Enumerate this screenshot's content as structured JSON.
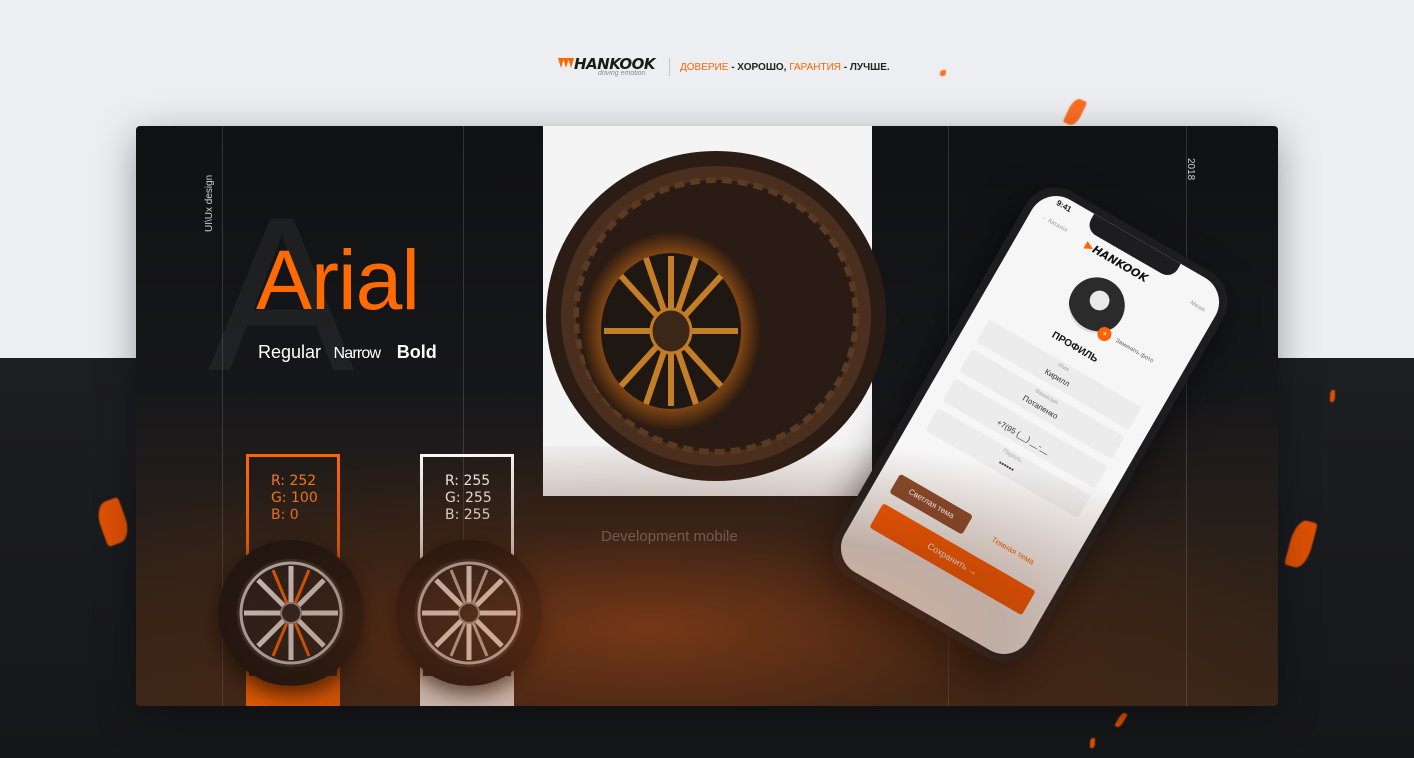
{
  "header": {
    "logo_text": "HANKOOK",
    "logo_sub": "driving emotion",
    "tagline_part1": "ДОВЕРИЕ",
    "tagline_part2": " - ХОРОШО, ",
    "tagline_part3": "ГАРАНТИЯ",
    "tagline_part4": " - ЛУЧШЕ."
  },
  "showcase": {
    "side_label": "UI\\Ux design",
    "year": "2018",
    "big_letter": "A",
    "font_name": "Arial",
    "weights": {
      "regular": "Regular",
      "narrow": "Narrow",
      "bold": "Bold"
    },
    "dev_text": "Development mobile"
  },
  "swatches": [
    {
      "color": "#ff6400",
      "r": "R: 252",
      "g": "G: 100",
      "b": "B: 0"
    },
    {
      "color": "#ffffff",
      "r": "R: 255",
      "g": "G: 255",
      "b": "B: 255"
    }
  ],
  "phone": {
    "time": "9:41",
    "back": "← Каталог",
    "menu": "Меню",
    "logo": "HANKOOK",
    "change_photo": "Заменить фото",
    "title": "ПРОФИЛЬ",
    "fields": [
      {
        "label": "Имя",
        "value": "Кирилл"
      },
      {
        "label": "Фамилия",
        "value": "Потапенко"
      },
      {
        "label": "",
        "value": "+7(95 (__) __-__"
      },
      {
        "label": "Пароль",
        "value": "••••••"
      }
    ],
    "theme_light": "Светлая тема",
    "theme_dark": "Темная тема",
    "save": "Сохранить →"
  },
  "colors": {
    "accent": "#ff6400",
    "background": "#eceef2",
    "dark": "#16171a"
  }
}
